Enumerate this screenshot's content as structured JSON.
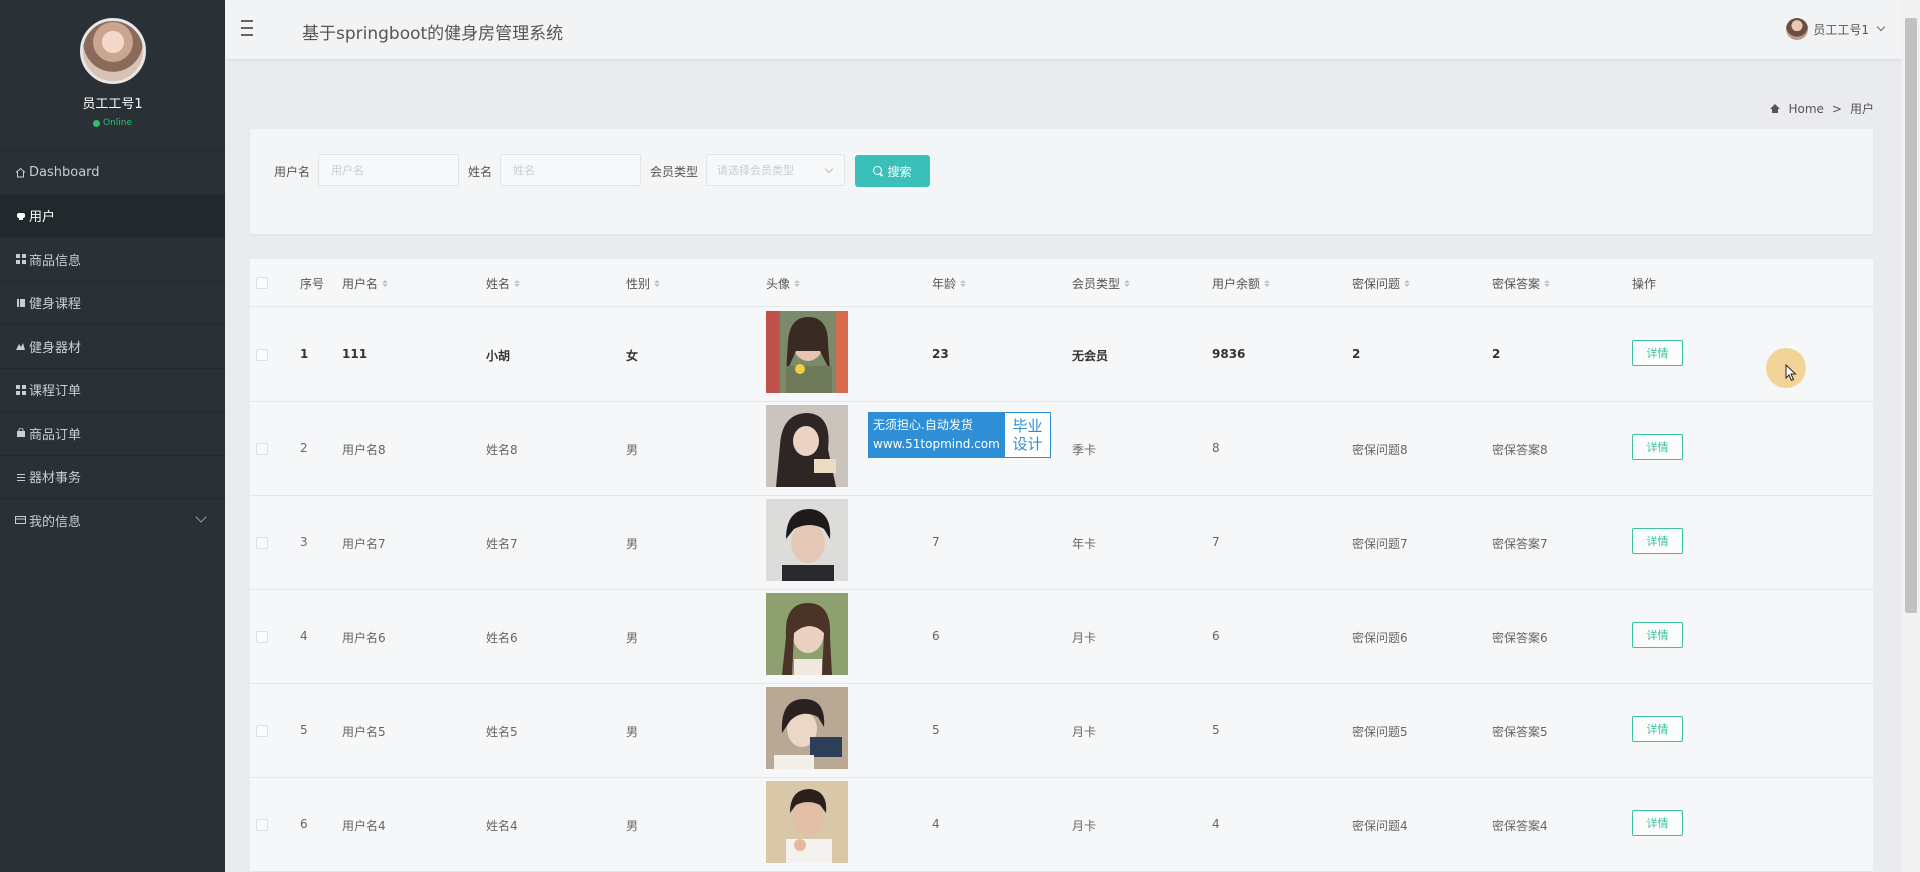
{
  "app_title": "基于springboot的健身房管理系统",
  "user": {
    "name": "员工工号1",
    "status": "Online"
  },
  "sidebar": {
    "items": [
      {
        "label": "Dashboard",
        "icon": "home-icon"
      },
      {
        "label": "用户",
        "icon": "user-icon",
        "active": true
      },
      {
        "label": "商品信息",
        "icon": "grid-icon"
      },
      {
        "label": "健身课程",
        "icon": "book-icon"
      },
      {
        "label": "健身器材",
        "icon": "dumbbell-icon"
      },
      {
        "label": "课程订单",
        "icon": "grid-icon"
      },
      {
        "label": "商品订单",
        "icon": "bag-icon"
      },
      {
        "label": "器材事务",
        "icon": "list-icon"
      },
      {
        "label": "我的信息",
        "icon": "card-icon",
        "has_submenu": true
      }
    ]
  },
  "breadcrumb": {
    "home": "Home",
    "separator": ">",
    "current": "用户"
  },
  "search": {
    "username_label": "用户名",
    "username_placeholder": "用户名",
    "name_label": "姓名",
    "name_placeholder": "姓名",
    "member_type_label": "会员类型",
    "member_type_placeholder": "请选择会员类型",
    "button": "搜索"
  },
  "table": {
    "columns": [
      "序号",
      "用户名",
      "姓名",
      "性别",
      "头像",
      "年龄",
      "会员类型",
      "用户余额",
      "密保问题",
      "密保答案",
      "操作"
    ],
    "action_label": "详情",
    "rows": [
      {
        "no": "1",
        "username": "111",
        "name": "小胡",
        "gender": "女",
        "age": "23",
        "member_type": "无会员",
        "balance": "9836",
        "question": "2",
        "answer": "2"
      },
      {
        "no": "2",
        "username": "用户名8",
        "name": "姓名8",
        "gender": "男",
        "age": "8",
        "member_type": "季卡",
        "balance": "8",
        "question": "密保问题8",
        "answer": "密保答案8"
      },
      {
        "no": "3",
        "username": "用户名7",
        "name": "姓名7",
        "gender": "男",
        "age": "7",
        "member_type": "年卡",
        "balance": "7",
        "question": "密保问题7",
        "answer": "密保答案7"
      },
      {
        "no": "4",
        "username": "用户名6",
        "name": "姓名6",
        "gender": "男",
        "age": "6",
        "member_type": "月卡",
        "balance": "6",
        "question": "密保问题6",
        "answer": "密保答案6"
      },
      {
        "no": "5",
        "username": "用户名5",
        "name": "姓名5",
        "gender": "男",
        "age": "5",
        "member_type": "月卡",
        "balance": "5",
        "question": "密保问题5",
        "answer": "密保答案5"
      },
      {
        "no": "6",
        "username": "用户名4",
        "name": "姓名4",
        "gender": "男",
        "age": "4",
        "member_type": "月卡",
        "balance": "4",
        "question": "密保问题4",
        "answer": "密保答案4"
      }
    ]
  },
  "watermark": {
    "line1": "无须担心.自动发货",
    "line2": "www.51topmind.com",
    "right1": "毕业",
    "right2": "设计"
  },
  "colors": {
    "sidebar_bg": "#2a3136",
    "accent": "#3bbfb9",
    "detail_border": "#3bbfa1",
    "online": "#2fbf71"
  }
}
